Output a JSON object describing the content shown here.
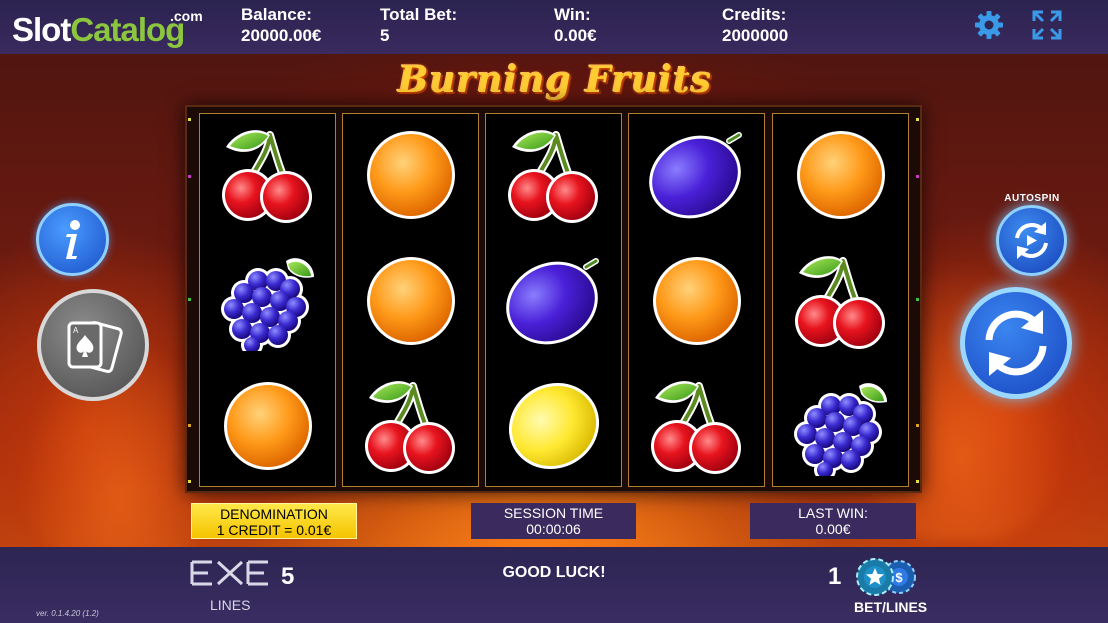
{
  "header": {
    "logo_main": "Slot",
    "logo_accent": "Catalog",
    "logo_suffix": ".com",
    "balance_label": "Balance:",
    "balance_value": "20000.00€",
    "total_bet_label": "Total Bet:",
    "total_bet_value": "5",
    "win_label": "Win:",
    "win_value": "0.00€",
    "credits_label": "Credits:",
    "credits_value": "2000000"
  },
  "game": {
    "title": "Burning Fruits"
  },
  "reels": [
    [
      "cherry",
      "grapes",
      "orange"
    ],
    [
      "orange",
      "orange",
      "cherry"
    ],
    [
      "cherry",
      "plum",
      "lemon"
    ],
    [
      "plum",
      "orange",
      "cherry"
    ],
    [
      "orange",
      "cherry",
      "grapes"
    ]
  ],
  "info_boxes": {
    "denomination_label": "DENOMINATION",
    "denomination_value": "1 CREDIT = 0.01€",
    "session_label": "SESSION TIME",
    "session_value": "00:00:06",
    "last_win_label": "LAST WIN:",
    "last_win_value": "0.00€"
  },
  "footer": {
    "lines_value": "5",
    "lines_label": "LINES",
    "message": "GOOD LUCK!",
    "bet_lines_value": "1",
    "bet_lines_label": "BET/LINES",
    "version": "ver. 0.1.4.20 (1.2)"
  },
  "controls": {
    "autospin_label": "AUTOSPIN"
  },
  "colors": {
    "accent_blue": "#2f7ae5",
    "logo_green": "#8cc63f",
    "denom_yellow": "#f5c400",
    "bar_purple": "#3a2a5e"
  }
}
